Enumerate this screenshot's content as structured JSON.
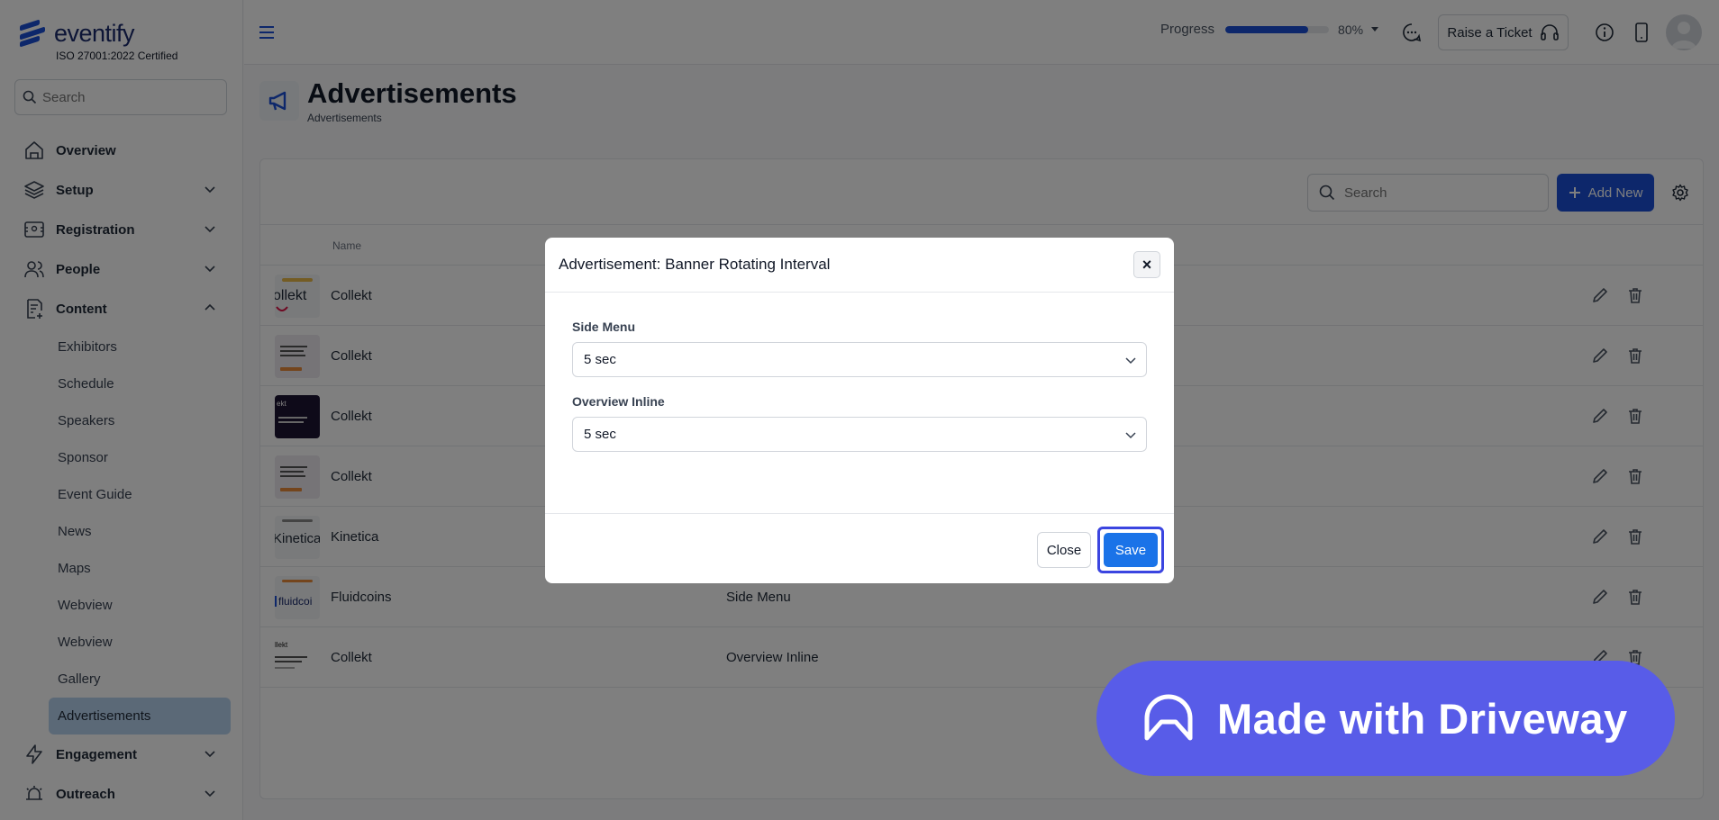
{
  "brand": {
    "name": "eventify",
    "tagline": "ISO 27001:2022 Certified",
    "color": "#1a4fd6"
  },
  "sidebar": {
    "search_placeholder": "Search",
    "items": [
      {
        "label": "Overview",
        "icon": "home-icon",
        "expandable": false
      },
      {
        "label": "Setup",
        "icon": "layers-icon",
        "expandable": true
      },
      {
        "label": "Registration",
        "icon": "registration-icon",
        "expandable": true
      },
      {
        "label": "People",
        "icon": "people-icon",
        "expandable": true
      },
      {
        "label": "Content",
        "icon": "content-icon",
        "expandable": true,
        "expanded": true
      }
    ],
    "content_sub": [
      "Exhibitors",
      "Schedule",
      "Speakers",
      "Sponsor",
      "Event Guide",
      "News",
      "Maps",
      "Webview",
      "Webview",
      "Gallery",
      "Advertisements"
    ],
    "active_sub": "Advertisements",
    "bottom_items": [
      {
        "label": "Engagement",
        "icon": "lightning-icon"
      },
      {
        "label": "Outreach",
        "icon": "alarm-icon"
      }
    ]
  },
  "topbar": {
    "progress_label": "Progress",
    "progress_value": 80,
    "progress_text": "80%",
    "ticket_label": "Raise a Ticket"
  },
  "page": {
    "title": "Advertisements",
    "breadcrumb": "Advertisements"
  },
  "table": {
    "search_placeholder": "Search",
    "add_label": "Add New",
    "header_name": "Name",
    "rows": [
      {
        "name": "Collekt",
        "position": "",
        "thumb": "collekt-logo"
      },
      {
        "name": "Collekt",
        "position": "",
        "thumb": "payments-banner"
      },
      {
        "name": "Collekt",
        "position": "",
        "thumb": "dark-banner"
      },
      {
        "name": "Collekt",
        "position": "",
        "thumb": "payments-banner"
      },
      {
        "name": "Kinetica",
        "position": "",
        "thumb": "kinetica-logo"
      },
      {
        "name": "Fluidcoins",
        "position": "Side Menu",
        "thumb": "fluidcoins-logo"
      },
      {
        "name": "Collekt",
        "position": "Overview Inline",
        "thumb": "collekt-banner"
      }
    ]
  },
  "modal": {
    "title": "Advertisement: Banner Rotating Interval",
    "fields": [
      {
        "label": "Side Menu",
        "value": "5 sec"
      },
      {
        "label": "Overview Inline",
        "value": "5 sec"
      }
    ],
    "close_label": "Close",
    "save_label": "Save"
  },
  "watermark": {
    "text": "Made with Driveway",
    "color": "#585ce8"
  }
}
